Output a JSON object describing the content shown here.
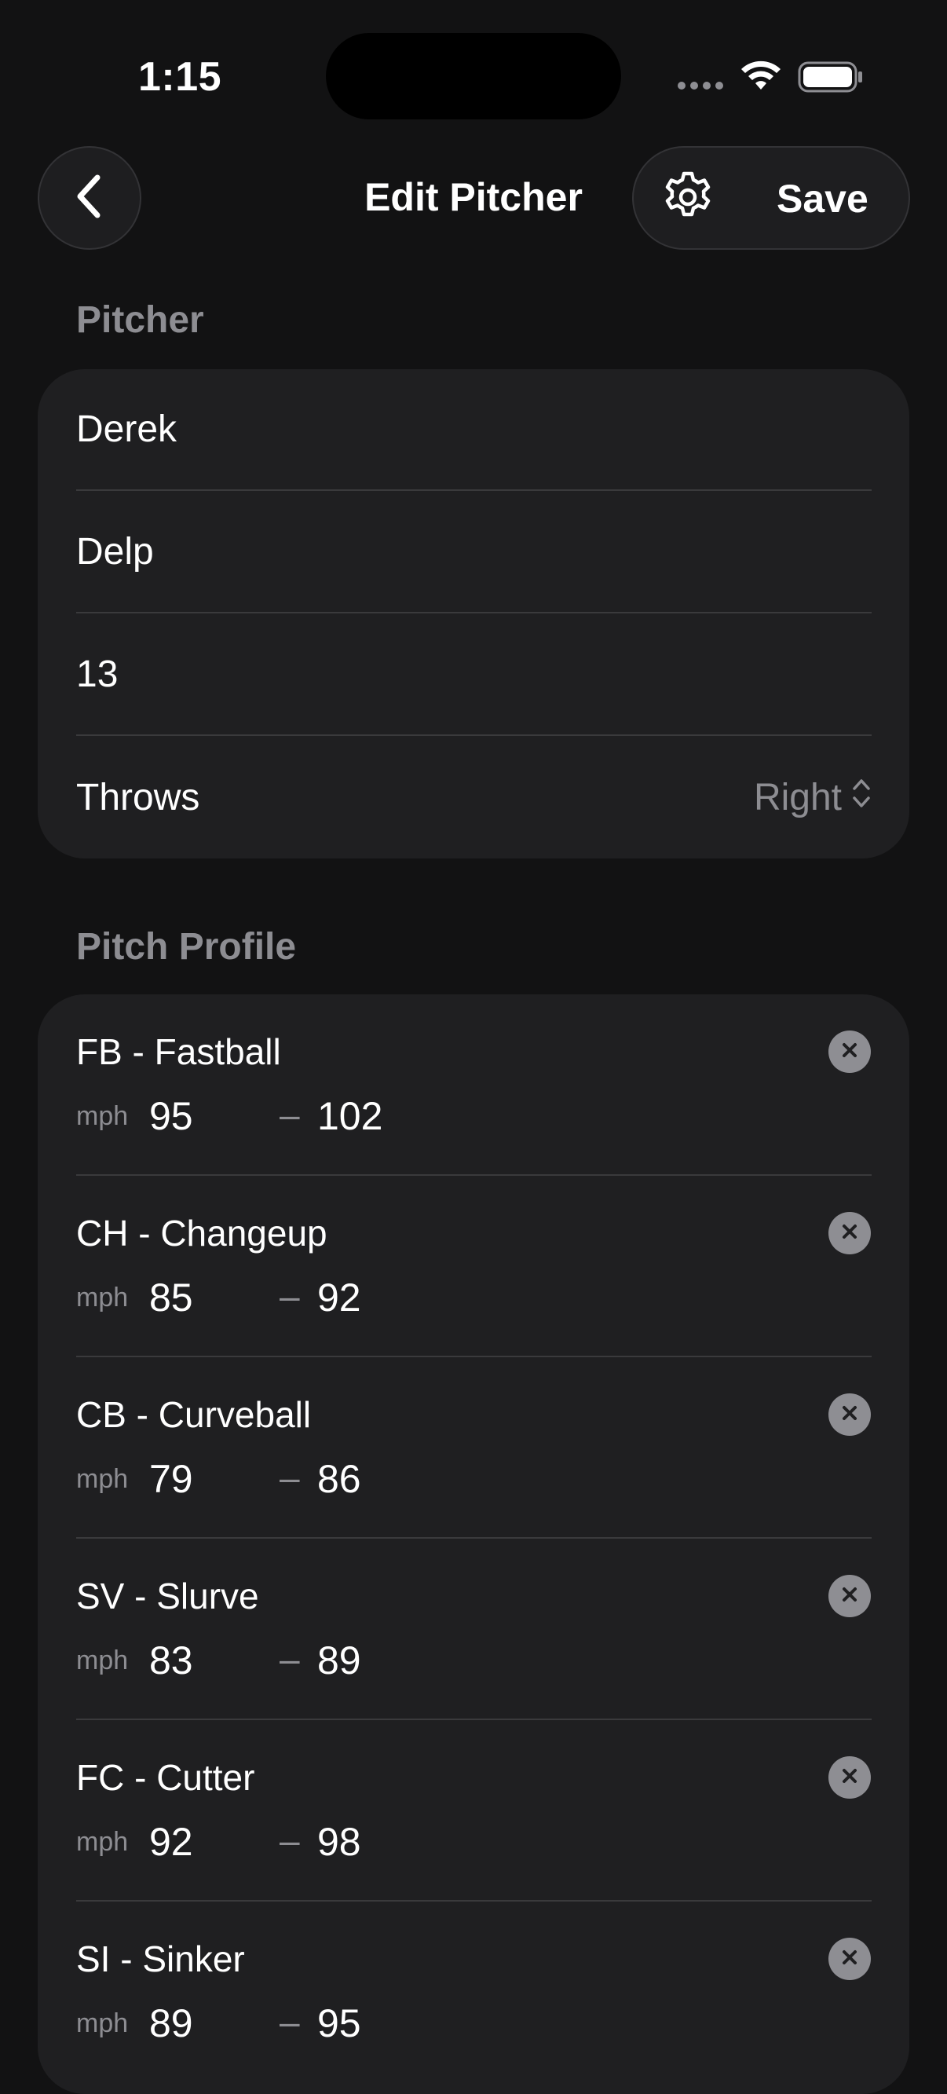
{
  "status_bar": {
    "time": "1:15"
  },
  "nav": {
    "title": "Edit Pitcher",
    "save_label": "Save",
    "back_icon": "chevron-left-icon",
    "settings_icon": "gear-icon"
  },
  "pitcher_section": {
    "header": "Pitcher",
    "first_name": "Derek",
    "last_name": "Delp",
    "number": "13",
    "throws_label": "Throws",
    "throws_value": "Right"
  },
  "pitch_profile": {
    "header": "Pitch Profile",
    "unit": "mph",
    "pitches": [
      {
        "name": "FB - Fastball",
        "min": "95",
        "max": "102"
      },
      {
        "name": "CH - Changeup",
        "min": "85",
        "max": "92"
      },
      {
        "name": "CB - Curveball",
        "min": "79",
        "max": "86"
      },
      {
        "name": "SV - Slurve",
        "min": "83",
        "max": "89"
      },
      {
        "name": "FC - Cutter",
        "min": "92",
        "max": "98"
      },
      {
        "name": "SI - Sinker",
        "min": "89",
        "max": "95"
      }
    ]
  },
  "colors": {
    "background": "#121213",
    "card": "#1f1f21",
    "secondary_text": "#8d8d92",
    "separator": "#3a3a3c"
  }
}
